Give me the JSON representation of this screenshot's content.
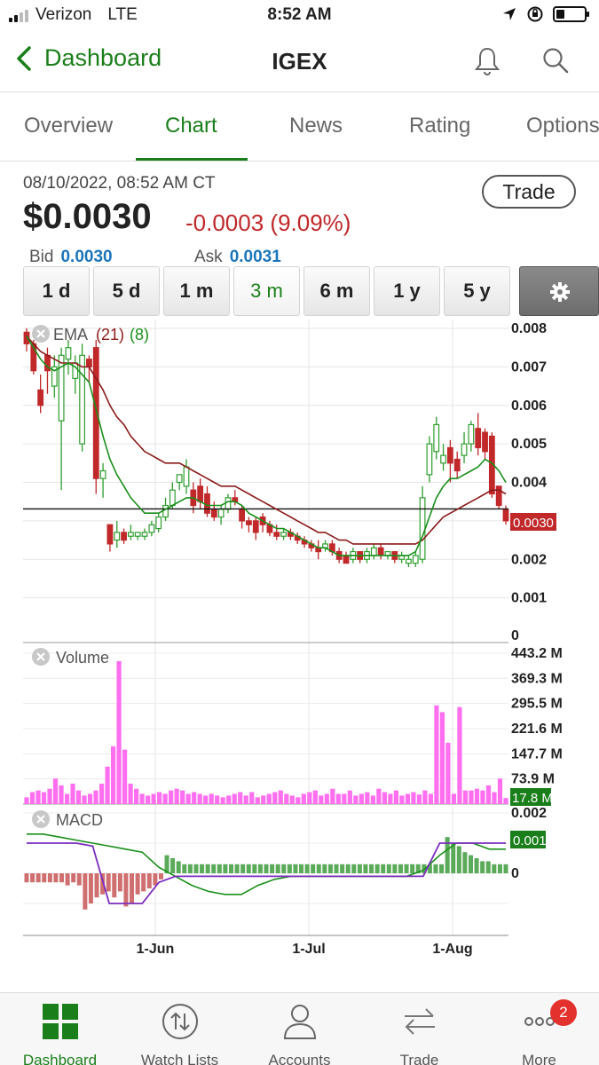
{
  "status_bar": {
    "carrier": "Verizon",
    "network": "LTE",
    "time": "8:52 AM"
  },
  "nav": {
    "back_label": "Dashboard",
    "title": "IGEX"
  },
  "tabs": [
    {
      "label": "Overview"
    },
    {
      "label": "Chart"
    },
    {
      "label": "News"
    },
    {
      "label": "Rating"
    },
    {
      "label": "Options"
    }
  ],
  "quote": {
    "timestamp": "08/10/2022, 08:52 AM CT",
    "price": "$0.0030",
    "change": "-0.0003",
    "change_pct": "(9.09%)",
    "bid_label": "Bid",
    "bid": "0.0030",
    "ask_label": "Ask",
    "ask": "0.0031",
    "trade_label": "Trade"
  },
  "ranges": [
    {
      "label": "1 d"
    },
    {
      "label": "5 d"
    },
    {
      "label": "1 m"
    },
    {
      "label": "3 m",
      "active": true
    },
    {
      "label": "6 m"
    },
    {
      "label": "1 y"
    },
    {
      "label": "5 y"
    }
  ],
  "colors": {
    "accent": "#1a7f1a",
    "down": "#c0282a",
    "up": "#2e9e2e",
    "ema21": "#8b1a1a",
    "ema8": "#1a8f1a",
    "volume": "#ff6ff0",
    "macd_signal": "#7b2cbf",
    "badge": "#e3312d"
  },
  "chart_data": [
    {
      "type": "candlestick",
      "title": "EMA",
      "legend": [
        {
          "name": "(21)"
        },
        {
          "name": "(8)"
        }
      ],
      "x_ticks": [
        "1-Jun",
        "1-Jul",
        "1-Aug"
      ],
      "y_ticks": [
        "0.008",
        "0.007",
        "0.006",
        "0.005",
        "0.004",
        "0.002",
        "0.001",
        "0"
      ],
      "ylim": [
        0,
        0.008
      ],
      "last_price_label": "0.0030",
      "price_line": 0.00331,
      "candles": [
        [
          0.0079,
          0.0076,
          0.008,
          0.0074
        ],
        [
          0.0076,
          0.0069,
          0.0077,
          0.0068
        ],
        [
          0.0064,
          0.006,
          0.0068,
          0.0058
        ],
        [
          0.0073,
          0.0069,
          0.0075,
          0.0063
        ],
        [
          0.0065,
          0.007,
          0.0073,
          0.0062
        ],
        [
          0.0056,
          0.0073,
          0.0075,
          0.0038
        ],
        [
          0.0072,
          0.0075,
          0.0077,
          0.0068
        ],
        [
          0.0067,
          0.0071,
          0.0073,
          0.0063
        ],
        [
          0.005,
          0.0073,
          0.0076,
          0.0048
        ],
        [
          0.0072,
          0.007,
          0.0073,
          0.0066
        ],
        [
          0.0075,
          0.0041,
          0.0077,
          0.0037
        ],
        [
          0.0041,
          0.0043,
          0.0045,
          0.0036
        ],
        [
          0.0029,
          0.0024,
          0.0029,
          0.0022
        ],
        [
          0.0025,
          0.0027,
          0.003,
          0.0023
        ],
        [
          0.0027,
          0.0025,
          0.0028,
          0.0024
        ],
        [
          0.0026,
          0.0027,
          0.0029,
          0.0025
        ],
        [
          0.0026,
          0.0027,
          0.0027,
          0.0025
        ],
        [
          0.0026,
          0.0027,
          0.0028,
          0.0025
        ],
        [
          0.0027,
          0.0029,
          0.003,
          0.0026
        ],
        [
          0.0028,
          0.0031,
          0.0032,
          0.0027
        ],
        [
          0.0031,
          0.0034,
          0.0036,
          0.003
        ],
        [
          0.0034,
          0.0038,
          0.004,
          0.0033
        ],
        [
          0.004,
          0.0042,
          0.0042,
          0.0038
        ],
        [
          0.0039,
          0.0044,
          0.0046,
          0.0037
        ],
        [
          0.0038,
          0.0034,
          0.004,
          0.0032
        ],
        [
          0.0039,
          0.0035,
          0.0041,
          0.0033
        ],
        [
          0.0037,
          0.0032,
          0.0039,
          0.0031
        ],
        [
          0.0033,
          0.0031,
          0.0035,
          0.003
        ],
        [
          0.0031,
          0.0033,
          0.0034,
          0.0029
        ],
        [
          0.0033,
          0.0036,
          0.0037,
          0.0032
        ],
        [
          0.0036,
          0.0035,
          0.0038,
          0.0034
        ],
        [
          0.0033,
          0.003,
          0.0034,
          0.0028
        ],
        [
          0.003,
          0.0029,
          0.0031,
          0.0027
        ],
        [
          0.003,
          0.0027,
          0.0031,
          0.0025
        ],
        [
          0.0031,
          0.0029,
          0.0032,
          0.0027
        ],
        [
          0.0029,
          0.0027,
          0.003,
          0.0026
        ],
        [
          0.0027,
          0.0026,
          0.0029,
          0.0025
        ],
        [
          0.0026,
          0.0027,
          0.0028,
          0.0025
        ],
        [
          0.0027,
          0.0026,
          0.0028,
          0.0025
        ],
        [
          0.0026,
          0.0025,
          0.0027,
          0.0024
        ],
        [
          0.0025,
          0.0024,
          0.0026,
          0.0023
        ],
        [
          0.0024,
          0.0023,
          0.0025,
          0.0022
        ],
        [
          0.0023,
          0.0022,
          0.0025,
          0.002
        ],
        [
          0.0023,
          0.0024,
          0.0025,
          0.0022
        ],
        [
          0.0024,
          0.0022,
          0.0025,
          0.0021
        ],
        [
          0.0022,
          0.002,
          0.0023,
          0.0019
        ],
        [
          0.0021,
          0.0019,
          0.0022,
          0.0019
        ],
        [
          0.002,
          0.0022,
          0.0023,
          0.0019
        ],
        [
          0.0022,
          0.002,
          0.0022,
          0.0019
        ],
        [
          0.002,
          0.0022,
          0.0023,
          0.0019
        ],
        [
          0.0021,
          0.0023,
          0.0024,
          0.002
        ],
        [
          0.0023,
          0.0021,
          0.0024,
          0.002
        ],
        [
          0.0021,
          0.0022,
          0.0022,
          0.002
        ],
        [
          0.0022,
          0.002,
          0.0022,
          0.0019
        ],
        [
          0.002,
          0.0021,
          0.0022,
          0.0019
        ],
        [
          0.0019,
          0.002,
          0.0021,
          0.0018
        ],
        [
          0.0019,
          0.0021,
          0.0022,
          0.0018
        ],
        [
          0.002,
          0.0036,
          0.0039,
          0.0019
        ],
        [
          0.0042,
          0.005,
          0.0052,
          0.004
        ],
        [
          0.0048,
          0.0055,
          0.0057,
          0.0046
        ],
        [
          0.0045,
          0.0047,
          0.005,
          0.0043
        ],
        [
          0.0049,
          0.0045,
          0.0051,
          0.004
        ],
        [
          0.0046,
          0.0043,
          0.0048,
          0.0041
        ],
        [
          0.0047,
          0.005,
          0.0053,
          0.0045
        ],
        [
          0.005,
          0.0055,
          0.0056,
          0.0048
        ],
        [
          0.0054,
          0.0049,
          0.0058,
          0.0047
        ],
        [
          0.0053,
          0.0048,
          0.0054,
          0.0046
        ],
        [
          0.0052,
          0.0037,
          0.0053,
          0.0036
        ],
        [
          0.0039,
          0.0034,
          0.0039,
          0.0033
        ],
        [
          0.0033,
          0.003,
          0.0034,
          0.0029
        ]
      ],
      "series": [
        {
          "name": "EMA (21)",
          "values": [
            0.0078,
            0.0076,
            0.0074,
            0.0073,
            0.0072,
            0.0071,
            0.0071,
            0.0071,
            0.007,
            0.007,
            0.0067,
            0.0064,
            0.006,
            0.0057,
            0.0055,
            0.0052,
            0.005,
            0.0048,
            0.0047,
            0.0046,
            0.0045,
            0.0045,
            0.0045,
            0.0044,
            0.0043,
            0.0042,
            0.0041,
            0.004,
            0.0039,
            0.0039,
            0.0039,
            0.0038,
            0.0037,
            0.0036,
            0.0035,
            0.0034,
            0.0033,
            0.0032,
            0.0031,
            0.003,
            0.0029,
            0.0028,
            0.0027,
            0.0027,
            0.0026,
            0.0025,
            0.0025,
            0.0024,
            0.0024,
            0.0024,
            0.0024,
            0.0024,
            0.0024,
            0.0024,
            0.0024,
            0.0024,
            0.0024,
            0.0025,
            0.0027,
            0.0029,
            0.0031,
            0.0032,
            0.0033,
            0.0034,
            0.0035,
            0.0036,
            0.0037,
            0.0038,
            0.0038,
            0.0037
          ]
        },
        {
          "name": "EMA (8)",
          "values": [
            0.0078,
            0.0075,
            0.0072,
            0.007,
            0.0069,
            0.007,
            0.0071,
            0.007,
            0.0068,
            0.0066,
            0.0059,
            0.0052,
            0.0046,
            0.0042,
            0.0039,
            0.0036,
            0.0034,
            0.0032,
            0.0032,
            0.0032,
            0.0033,
            0.0034,
            0.0035,
            0.0036,
            0.0036,
            0.0035,
            0.0034,
            0.0034,
            0.0034,
            0.0035,
            0.0035,
            0.0034,
            0.0032,
            0.0031,
            0.003,
            0.0029,
            0.0028,
            0.0028,
            0.0027,
            0.0026,
            0.0025,
            0.0024,
            0.0023,
            0.0023,
            0.0022,
            0.0021,
            0.0021,
            0.0021,
            0.0021,
            0.0021,
            0.0021,
            0.0021,
            0.0021,
            0.0021,
            0.0021,
            0.0021,
            0.0022,
            0.0026,
            0.0031,
            0.0036,
            0.0039,
            0.0041,
            0.0041,
            0.0042,
            0.0043,
            0.0044,
            0.0046,
            0.0045,
            0.0043,
            0.004
          ]
        }
      ]
    },
    {
      "type": "bar",
      "title": "Volume",
      "y_ticks": [
        "443.2 M",
        "369.3 M",
        "295.5 M",
        "221.6 M",
        "147.7 M",
        "73.9 M"
      ],
      "ylim": [
        0,
        443.2
      ],
      "last_value_label": "17.8 M",
      "values": [
        20,
        35,
        40,
        35,
        45,
        75,
        55,
        30,
        60,
        40,
        25,
        30,
        40,
        60,
        110,
        170,
        420,
        160,
        60,
        45,
        30,
        25,
        30,
        35,
        30,
        40,
        45,
        40,
        30,
        35,
        30,
        25,
        30,
        25,
        20,
        25,
        30,
        35,
        25,
        35,
        20,
        25,
        30,
        35,
        40,
        30,
        25,
        20,
        30,
        35,
        40,
        25,
        30,
        45,
        30,
        30,
        40,
        25,
        30,
        35,
        25,
        45,
        35,
        30,
        40,
        25,
        30,
        35,
        28,
        40,
        30,
        290,
        270,
        180,
        30,
        285,
        40,
        40,
        45,
        40,
        55,
        35,
        75,
        17.8
      ]
    },
    {
      "type": "bar",
      "title": "MACD",
      "y_ticks": [
        "0.002",
        "0.001",
        "0"
      ],
      "last_value_label": "0.001",
      "values": [
        -0.0003,
        -0.0003,
        -0.0003,
        -0.0003,
        -0.0003,
        -0.0003,
        -0.0003,
        -0.0004,
        -0.0003,
        -0.0004,
        -0.0012,
        -0.001,
        -0.0008,
        -0.0007,
        -0.0006,
        -0.0008,
        -0.0006,
        -0.0011,
        -0.001,
        -0.0007,
        -0.0006,
        -0.0005,
        -0.0004,
        -0.0002,
        0.0006,
        0.0005,
        0.0004,
        0.0003,
        0.0003,
        0.0003,
        0.0003,
        0.0003,
        0.0003,
        0.0003,
        0.0003,
        0.0003,
        0.0003,
        0.0003,
        0.0003,
        0.0003,
        0.0003,
        0.0003,
        0.0003,
        0.0003,
        0.0003,
        0.0003,
        0.0003,
        0.0003,
        0.0003,
        0.0003,
        0.0003,
        0.0003,
        0.0003,
        0.0003,
        0.0003,
        0.0003,
        0.0003,
        0.0003,
        0.0003,
        0.0003,
        0.0003,
        0.0003,
        0.0003,
        0.0003,
        0.0003,
        0.0003,
        0.0003,
        0.0003,
        0.0003,
        0.0003,
        0.0003,
        0.0003,
        0.0012,
        0.001,
        0.0009,
        0.0007,
        0.0006,
        0.0005,
        0.0004,
        0.0004,
        0.0003,
        0.0003,
        0.0003
      ],
      "series": [
        {
          "name": "MACD",
          "values": [
            0.0013,
            0.0013,
            0.0012,
            0.0011,
            0.001,
            0.0009,
            0.0008,
            0.0007,
            0.0002,
            -0.0001,
            -0.0004,
            -0.0006,
            -0.0007,
            -0.0007,
            -0.0004,
            -0.0002,
            -0.0001,
            -0.0001,
            -0.0001,
            -0.0001,
            -0.0001,
            -0.0001,
            -0.0001,
            -0.0001,
            0.0001,
            0.0006,
            0.001,
            0.001,
            0.0008,
            0.0008
          ]
        },
        {
          "name": "Signal",
          "values": [
            0.001,
            0.001,
            0.001,
            0.001,
            0.0009,
            -0.001,
            -0.001,
            -0.001,
            -0.0003,
            -0.0001,
            -0.0001,
            -0.0001,
            -0.0001,
            -0.0001,
            -0.0001,
            -0.0001,
            -0.0001,
            -0.0001,
            -0.0001,
            -0.0001,
            -0.0001,
            -0.0001,
            -0.0001,
            -0.0001,
            -0.0001,
            0.001,
            0.001,
            0.001,
            0.001,
            0.001
          ]
        }
      ]
    }
  ],
  "tabbar": [
    {
      "label": "Dashboard",
      "icon": "grid-icon",
      "active": true
    },
    {
      "label": "Watch Lists",
      "icon": "arrows-circle-icon"
    },
    {
      "label": "Accounts",
      "icon": "person-icon"
    },
    {
      "label": "Trade",
      "icon": "swap-arrows-icon"
    },
    {
      "label": "More",
      "icon": "more-dots-icon",
      "badge": "2"
    }
  ]
}
